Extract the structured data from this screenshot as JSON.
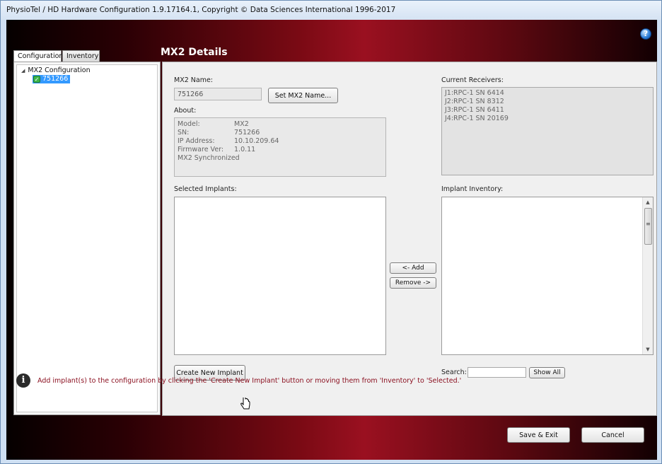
{
  "window": {
    "title": "PhysioTel / HD Hardware Configuration 1.9.17164.1, Copyright © Data Sciences International 1996-2017"
  },
  "header": {
    "title": "MX2 Details",
    "help_icon": "question-circle-icon",
    "help_glyph": "?"
  },
  "tabs": [
    {
      "label": "Configuration",
      "active": true
    },
    {
      "label": "Inventory",
      "active": false
    }
  ],
  "tree": {
    "root_label": "MX2 Configuration",
    "caret": "◢",
    "child_label": "751266",
    "child_status_icon": "green-check-icon",
    "check_glyph": "✓"
  },
  "mx2": {
    "name_label": "MX2 Name:",
    "name_value": "751266",
    "set_name_button": "Set MX2 Name..."
  },
  "about": {
    "label": "About:",
    "rows": [
      {
        "key": "Model:",
        "value": "MX2"
      },
      {
        "key": "SN:",
        "value": "751266"
      },
      {
        "key": "IP Address:",
        "value": "10.10.209.64"
      },
      {
        "key": "Firmware Ver:",
        "value": "1.0.11"
      }
    ],
    "status": "MX2 Synchronized"
  },
  "receivers": {
    "label": "Current Receivers:",
    "items": [
      "J1:RPC-1 SN 6414",
      "J2:RPC-1 SN 8312",
      "J3:RPC-1 SN 6411",
      "J4:RPC-1 SN 20169"
    ]
  },
  "selected_implants": {
    "label": "Selected Implants:",
    "items": []
  },
  "implant_inventory": {
    "label": "Implant Inventory:",
    "items": [],
    "scroll_up": "▲",
    "scroll_down": "▼"
  },
  "transfer": {
    "add_label": "<- Add",
    "remove_label": "Remove ->"
  },
  "create_button": "Create New Implant",
  "search": {
    "label": "Search:",
    "value": "",
    "show_all_button": "Show All"
  },
  "info": {
    "icon": "info-circle-icon",
    "glyph": "i",
    "message": "Add implant(s) to the configuration by clicking the 'Create New Implant' button or moving them from 'Inventory' to 'Selected.'"
  },
  "footer": {
    "save_exit_button": "Save & Exit",
    "cancel_button": "Cancel"
  },
  "colors": {
    "accent_dark_red": "#7a0a14",
    "selection_blue": "#3399ff",
    "info_text": "#8b1020"
  }
}
